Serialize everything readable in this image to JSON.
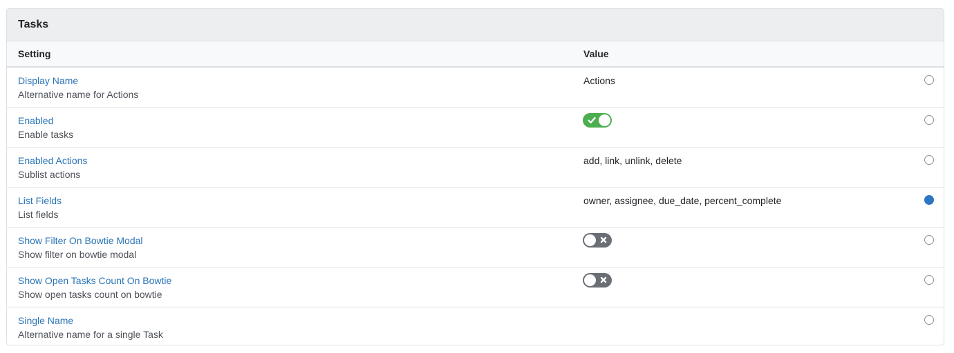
{
  "panel": {
    "title": "Tasks"
  },
  "columns": {
    "setting": "Setting",
    "value": "Value"
  },
  "rows": [
    {
      "name": "Display Name",
      "description": "Alternative name for Actions",
      "value": "Actions",
      "selected": false
    },
    {
      "name": "Enabled",
      "description": "Enable tasks",
      "toggle": "on",
      "selected": false
    },
    {
      "name": "Enabled Actions",
      "description": "Sublist actions",
      "value": "add, link, unlink, delete",
      "selected": false
    },
    {
      "name": "List Fields",
      "description": "List fields",
      "value": "owner, assignee, due_date, percent_complete",
      "selected": true
    },
    {
      "name": "Show Filter On Bowtie Modal",
      "description": "Show filter on bowtie modal",
      "toggle": "off",
      "selected": false
    },
    {
      "name": "Show Open Tasks Count On Bowtie",
      "description": "Show open tasks count on bowtie",
      "toggle": "off",
      "selected": false
    },
    {
      "name": "Single Name",
      "description": "Alternative name for a single Task",
      "value": "",
      "selected": false
    }
  ],
  "colors": {
    "link": "#2a74b8",
    "toggle_on": "#4cae4f",
    "toggle_off": "#6a6f76",
    "radio_selected": "#2d76c2"
  },
  "icons": {
    "toggle_on": "check-icon",
    "toggle_off": "x-icon"
  }
}
